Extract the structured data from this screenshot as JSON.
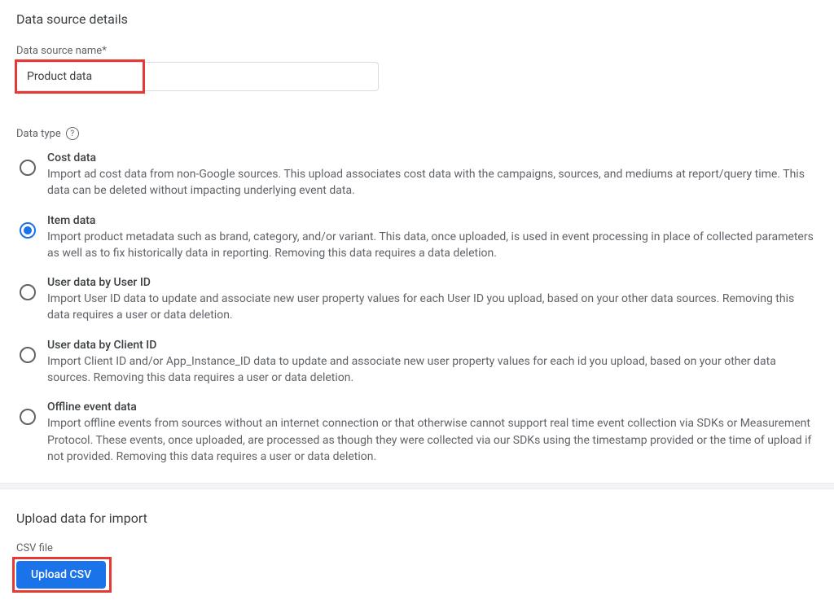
{
  "sectionTitle": "Data source details",
  "nameLabel": "Data source name*",
  "nameValue": "Product data",
  "dataTypeLabel": "Data type",
  "options": [
    {
      "title": "Cost data",
      "desc": "Import ad cost data from non-Google sources. This upload associates cost data with the campaigns, sources, and mediums at report/query time. This data can be deleted without impacting underlying event data.",
      "selected": false
    },
    {
      "title": "Item data",
      "desc": "Import product metadata such as brand, category, and/or variant. This data, once uploaded, is used in event processing in place of collected parameters as well as to fix historically data in reporting. Removing this data requires a data deletion.",
      "selected": true
    },
    {
      "title": "User data by User ID",
      "desc": "Import User ID data to update and associate new user property values for each User ID you upload, based on your other data sources. Removing this data requires a user or data deletion.",
      "selected": false
    },
    {
      "title": "User data by Client ID",
      "desc": "Import Client ID and/or App_Instance_ID data to update and associate new user property values for each id you upload, based on your other data sources. Removing this data requires a user or data deletion.",
      "selected": false
    },
    {
      "title": "Offline event data",
      "desc": "Import offline events from sources without an internet connection or that otherwise cannot support real time event collection via SDKs or Measurement Protocol. These events, once uploaded, are processed as though they were collected via our SDKs using the timestamp provided or the time of upload if not provided. Removing this data requires a user or data deletion.",
      "selected": false
    }
  ],
  "uploadTitle": "Upload data for import",
  "csvLabel": "CSV file",
  "uploadButton": "Upload CSV"
}
